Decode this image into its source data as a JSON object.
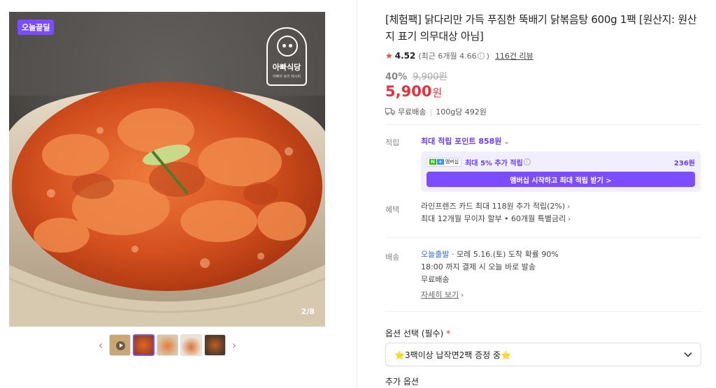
{
  "gallery": {
    "badge": "오늘끝딜",
    "brand_name": "아빠식당",
    "brand_sub": "아빠의 요리 레시피",
    "counter": "2/8",
    "thumbs": [
      "video",
      "photo",
      "photo",
      "photo",
      "photo"
    ],
    "active_thumb": 1
  },
  "product": {
    "title": "[체험팩] 닭다리만 가득 푸짐한 뚝배기 닭볶음탕 600g 1팩 [원산지: 원산지 표기 의무대상 아님]",
    "rating": "4.52",
    "recent_rating": "(최근 6개월 4.66",
    "recent_close": ")",
    "review_count": "116건 리뷰",
    "discount": "40%",
    "original_price": "9,900원",
    "price": "5,900",
    "price_unit": "원",
    "shipping": "무료배송",
    "unit_price": "100g당 492원"
  },
  "points": {
    "label": "적립",
    "max_points": "최대 적립 포인트 858원",
    "membership_badge": "멤버십",
    "membership_text": "최대 5% 추가 적립",
    "membership_amount": "236원",
    "membership_button": "멤버십 시작하고 최대 적립 받기 >"
  },
  "benefits": {
    "label": "혜택",
    "lines": [
      "라인프렌즈 카드 최대 118원 추가 적립(2%)",
      "최대 12개월 무이자 할부 • 60개월 특별금리"
    ]
  },
  "delivery": {
    "label": "배송",
    "today": "오늘출발",
    "arrival": " · 모레 5.16.(토) 도착 확률 90%",
    "cutoff": "18:00 까지 결제 시 오늘 바로 발송",
    "fee": "무료배송",
    "details_link": "자세히 보기"
  },
  "options": {
    "title": "옵션 선택 (필수)",
    "required_mark": "*",
    "selected": "⭐3팩이상 납작면2팩 증정 중⭐",
    "additional": "추가 옵션"
  },
  "colors": {
    "accent_purple": "#7c4dff",
    "price_red": "#e7303d",
    "star_red": "#e94a3d"
  }
}
